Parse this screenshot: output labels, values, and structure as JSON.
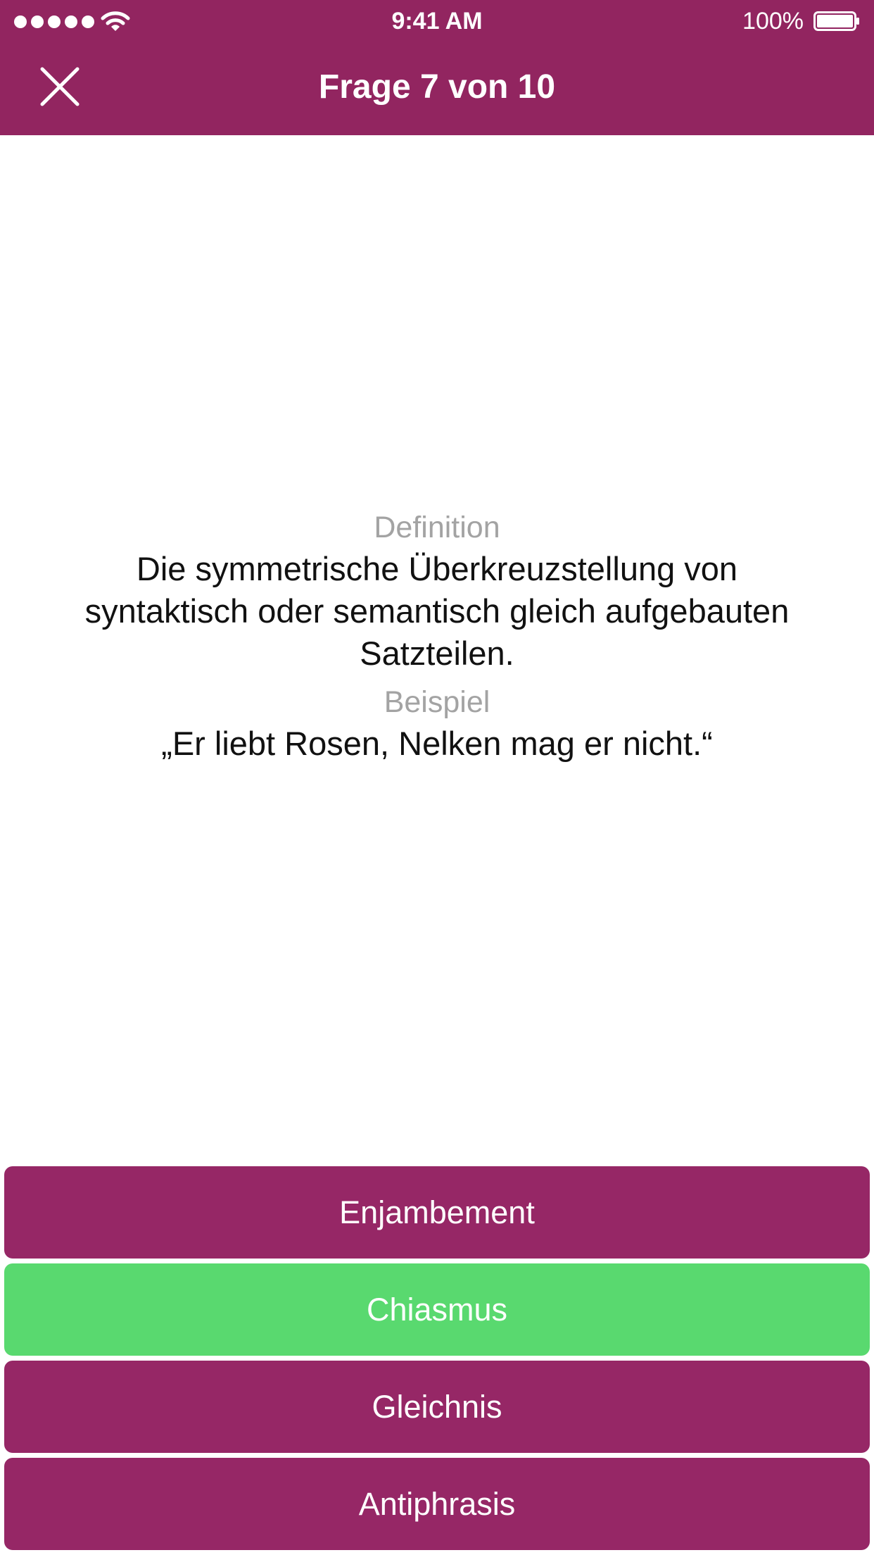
{
  "status_bar": {
    "time": "9:41 AM",
    "battery_percent": "100%",
    "signal_icon": "signal-dots-icon",
    "wifi_icon": "wifi-icon",
    "battery_icon": "battery-full-icon"
  },
  "nav": {
    "title": "Frage 7 von 10",
    "close_icon": "close-icon"
  },
  "question": {
    "definition_label": "Definition",
    "definition_text": "Die symmetrische Überkreuzstellung von syntaktisch oder semantisch gleich aufgebauten Satzteilen.",
    "example_label": "Beispiel",
    "example_text": "„Er liebt Rosen, Nelken mag er nicht.“"
  },
  "answers": [
    {
      "label": "Enjambement",
      "state": "default"
    },
    {
      "label": "Chiasmus",
      "state": "correct"
    },
    {
      "label": "Gleichnis",
      "state": "default"
    },
    {
      "label": "Antiphrasis",
      "state": "default"
    }
  ],
  "colors": {
    "brand": "#922560",
    "answer_default": "#962766",
    "answer_correct": "#59d96f",
    "label_gray": "#a3a3a3"
  }
}
